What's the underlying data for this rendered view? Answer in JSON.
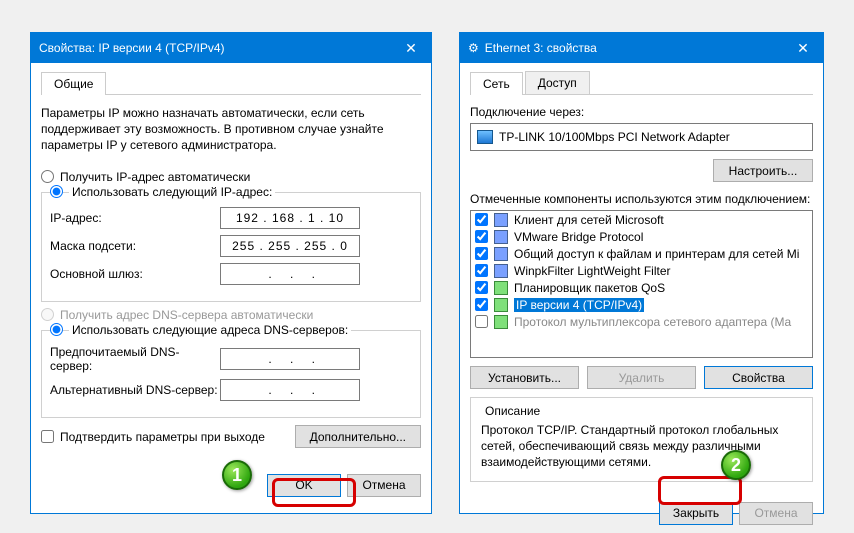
{
  "left": {
    "title": "Свойства: IP версии 4 (TCP/IPv4)",
    "tab": "Общие",
    "intro": "Параметры IP можно назначать автоматически, если сеть поддерживает эту возможность. В противном случае узнайте параметры IP у сетевого администратора.",
    "radio_ip_auto": "Получить IP-адрес автоматически",
    "radio_ip_manual": "Использовать следующий IP-адрес:",
    "ip_label": "IP-адрес:",
    "ip_value": "192 . 168 .   1  .  10",
    "mask_label": "Маска подсети:",
    "mask_value": "255 . 255 . 255 .   0",
    "gw_label": "Основной шлюз:",
    "radio_dns_auto": "Получить адрес DNS-сервера автоматически",
    "radio_dns_manual": "Использовать следующие адреса DNS-серверов:",
    "dns1_label": "Предпочитаемый DNS-сервер:",
    "dns2_label": "Альтернативный DNS-сервер:",
    "confirm_check": "Подтвердить параметры при выходе",
    "btn_adv": "Дополнительно...",
    "btn_ok": "OK",
    "btn_cancel": "Отмена"
  },
  "right": {
    "title": "Ethernet 3: свойства",
    "tab1": "Сеть",
    "tab2": "Доступ",
    "conn_label": "Подключение через:",
    "adapter": "TP-LINK 10/100Mbps PCI Network Adapter",
    "btn_config": "Настроить...",
    "comp_label": "Отмеченные компоненты используются этим подключением:",
    "components": [
      {
        "label": "Клиент для сетей Microsoft",
        "icon": "blue",
        "checked": true
      },
      {
        "label": "VMware Bridge Protocol",
        "icon": "blue",
        "checked": true
      },
      {
        "label": "Общий доступ к файлам и принтерам для сетей Mi",
        "icon": "blue",
        "checked": true
      },
      {
        "label": "WinpkFilter LightWeight Filter",
        "icon": "blue",
        "checked": true
      },
      {
        "label": "Планировщик пакетов QoS",
        "icon": "green",
        "checked": true
      },
      {
        "label": "IP версии 4 (TCP/IPv4)",
        "icon": "green",
        "checked": true,
        "selected": true
      },
      {
        "label": "Протокол мультиплексора сетевого адаптера (Ma",
        "icon": "green",
        "checked": false,
        "disabled": true
      }
    ],
    "btn_install": "Установить...",
    "btn_remove": "Удалить",
    "btn_props": "Свойства",
    "desc_title": "Описание",
    "desc_text": "Протокол TCP/IP. Стандартный протокол глобальных сетей, обеспечивающий связь между различными взаимодействующими сетями.",
    "btn_close": "Закрыть",
    "btn_cancel": "Отмена"
  },
  "markers": {
    "one": "1",
    "two": "2"
  }
}
